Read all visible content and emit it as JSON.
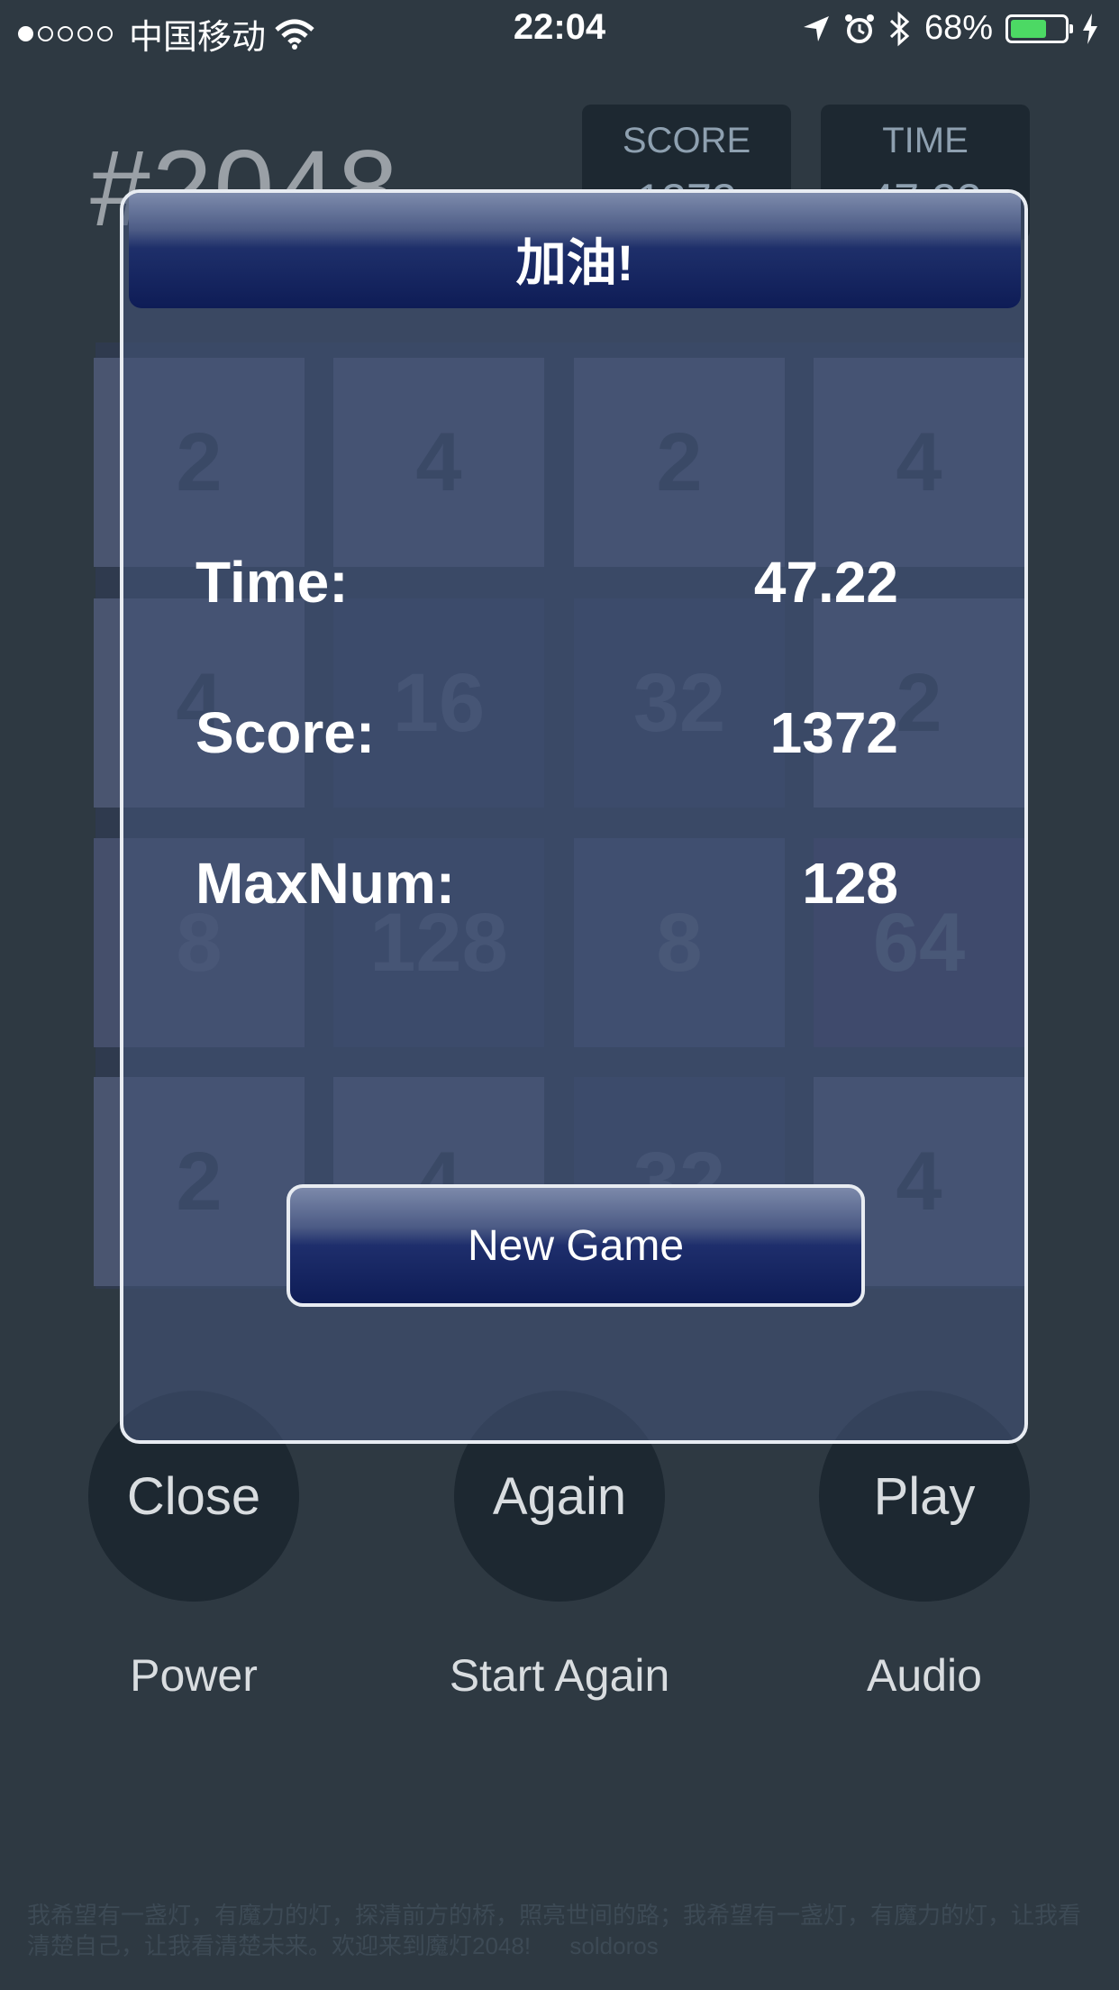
{
  "status_bar": {
    "carrier": "中国移动",
    "time": "22:04",
    "battery": "68%",
    "battery_level": 0.68
  },
  "header": {
    "title": "#2048",
    "score_label": "SCORE",
    "score_value": "1372",
    "time_label": "TIME",
    "time_value": "47.22"
  },
  "board": {
    "rows": [
      [
        "2",
        "4",
        "2",
        "4"
      ],
      [
        "4",
        "16",
        "32",
        "2"
      ],
      [
        "8",
        "128",
        "8",
        "64"
      ],
      [
        "2",
        "4",
        "32",
        "4"
      ]
    ]
  },
  "modal": {
    "title": "加油!",
    "time_label": "Time:",
    "time_value": "47.22",
    "score_label": "Score:",
    "score_value": "1372",
    "maxnum_label": "MaxNum:",
    "maxnum_value": "128",
    "new_game": "New Game"
  },
  "controls": {
    "close": "Close",
    "again": "Again",
    "play": "Play",
    "power": "Power",
    "start_again": "Start Again",
    "audio": "Audio"
  },
  "footer": {
    "text": "我希望有一盏灯，有魔力的灯，探清前方的桥，照亮世间的路；我希望有一盏灯，有魔力的灯，让我看清楚自己，让我看清楚未来。欢迎来到魔灯2048!",
    "author": "soldoros"
  },
  "colors": {
    "background": "#2e3942",
    "modal_header": "#0e1c56",
    "battery_fill": "#4cd964"
  }
}
